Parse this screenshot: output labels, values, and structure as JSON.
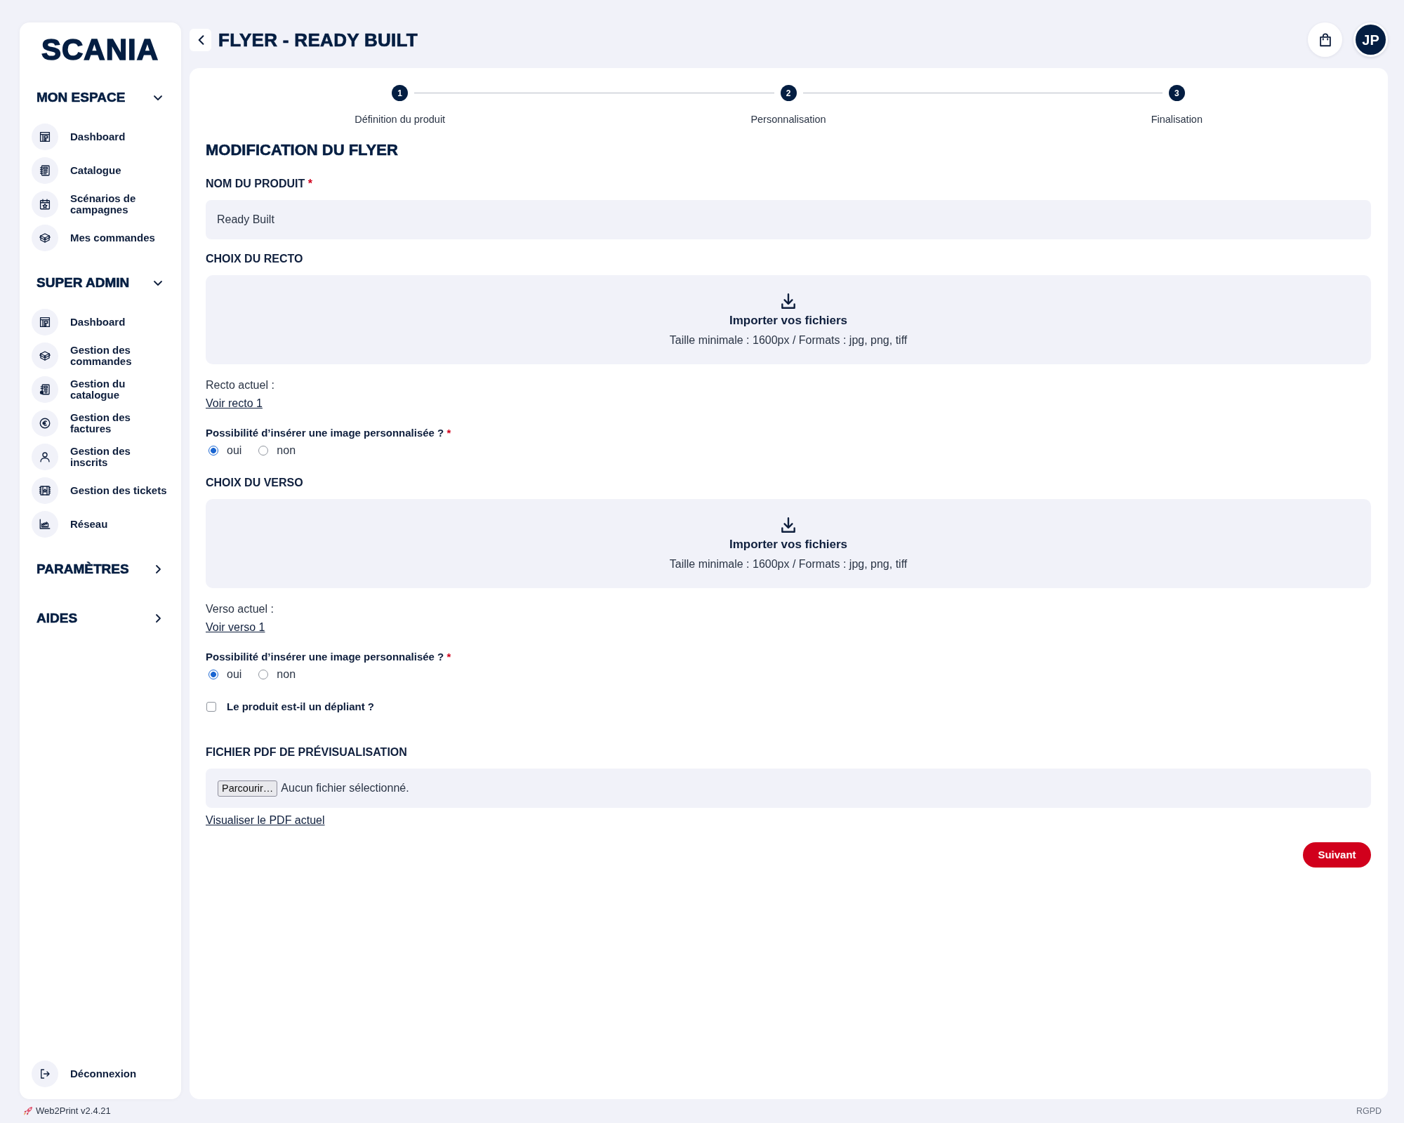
{
  "sidebar": {
    "logo": "SCANIA",
    "sections": [
      {
        "title": "MON ESPACE",
        "expanded": true,
        "items": [
          "Dashboard",
          "Catalogue",
          "Scénarios de campagnes",
          "Mes commandes"
        ]
      },
      {
        "title": "SUPER ADMIN",
        "expanded": true,
        "items": [
          "Dashboard",
          "Gestion des commandes",
          "Gestion du catalogue",
          "Gestion des factures",
          "Gestion des inscrits",
          "Gestion des tickets",
          "Réseau"
        ]
      },
      {
        "title": "PARAMÈTRES",
        "expanded": false
      },
      {
        "title": "AIDES",
        "expanded": false
      }
    ],
    "logout": "Déconnexion"
  },
  "header": {
    "title": "FLYER - READY BUILT",
    "avatar": "JP"
  },
  "stepper": {
    "steps": [
      {
        "number": "1",
        "label": "Définition du produit"
      },
      {
        "number": "2",
        "label": "Personnalisation"
      },
      {
        "number": "3",
        "label": "Finalisation"
      }
    ]
  },
  "form": {
    "title": "MODIFICATION DU FLYER",
    "fields": [
      {
        "kind": "text",
        "label": "NOM DU PRODUIT",
        "required_mark": "*",
        "value": "Ready Built"
      },
      {
        "kind": "upload",
        "label": "CHOIX DU RECTO",
        "action": "Importer vos fichiers",
        "hint": "Taille minimale : 1600px / Formats : jpg, png, tiff",
        "current_label": "Recto actuel :",
        "current_link": "Voir recto 1"
      },
      {
        "kind": "radio",
        "label": "Possibilité d’insérer une image personnalisée ?",
        "required_mark": "*",
        "options": [
          {
            "label": "oui",
            "selected": true
          },
          {
            "label": "non",
            "selected": false
          }
        ]
      },
      {
        "kind": "upload",
        "label": "CHOIX DU VERSO",
        "action": "Importer vos fichiers",
        "hint": "Taille minimale : 1600px / Formats : jpg, png, tiff",
        "current_label": "Verso actuel :",
        "current_link": "Voir verso 1"
      },
      {
        "kind": "radio",
        "label": "Possibilité d’insérer une image personnalisée ?",
        "required_mark": "*",
        "options": [
          {
            "label": "oui",
            "selected": true
          },
          {
            "label": "non",
            "selected": false
          }
        ]
      },
      {
        "kind": "checkbox",
        "label": "Le produit est-il un dépliant ?",
        "checked": false
      },
      {
        "kind": "file",
        "label": "FICHIER PDF DE PRÉVISUALISATION",
        "button": "Parcourir…",
        "status": "Aucun fichier sélectionné.",
        "link": "Visualiser le PDF actuel"
      }
    ],
    "submit": "Suivant"
  },
  "footer": {
    "version": "Web2Print v2.4.21",
    "link": "RGPD"
  }
}
